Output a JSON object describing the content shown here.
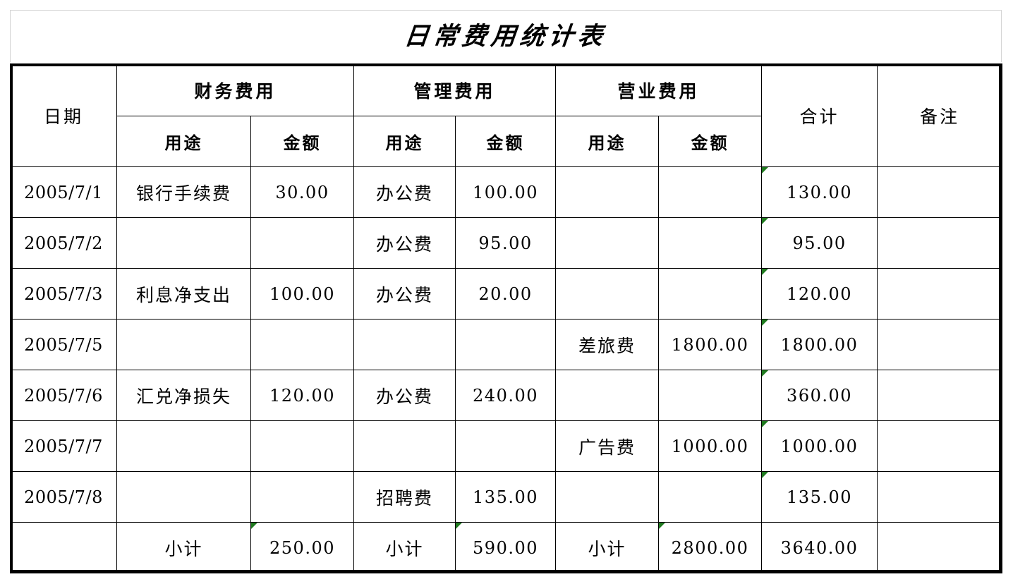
{
  "document": {
    "title": "日常费用统计表",
    "type": "spreadsheet"
  },
  "table": {
    "headers": {
      "date": "日期",
      "groups": [
        {
          "name": "财务费用",
          "sub": [
            "用途",
            "金额"
          ]
        },
        {
          "name": "管理费用",
          "sub": [
            "用途",
            "金额"
          ]
        },
        {
          "name": "营业费用",
          "sub": [
            "用途",
            "金额"
          ]
        }
      ],
      "total": "合计",
      "note": "备注"
    },
    "rows": [
      {
        "date": "2005/7/1",
        "finance_use": "银行手续费",
        "finance_amount": "30.00",
        "admin_use": "办公费",
        "admin_amount": "100.00",
        "sales_use": "",
        "sales_amount": "",
        "total": "130.00",
        "total_marker": true,
        "note": ""
      },
      {
        "date": "2005/7/2",
        "finance_use": "",
        "finance_amount": "",
        "admin_use": "办公费",
        "admin_amount": "95.00",
        "sales_use": "",
        "sales_amount": "",
        "total": "95.00",
        "total_marker": true,
        "note": ""
      },
      {
        "date": "2005/7/3",
        "finance_use": "利息净支出",
        "finance_amount": "100.00",
        "admin_use": "办公费",
        "admin_amount": "20.00",
        "sales_use": "",
        "sales_amount": "",
        "total": "120.00",
        "total_marker": true,
        "note": ""
      },
      {
        "date": "2005/7/5",
        "finance_use": "",
        "finance_amount": "",
        "admin_use": "",
        "admin_amount": "",
        "sales_use": "差旅费",
        "sales_amount": "1800.00",
        "total": "1800.00",
        "total_marker": true,
        "note": ""
      },
      {
        "date": "2005/7/6",
        "finance_use": "汇兑净损失",
        "finance_amount": "120.00",
        "admin_use": "办公费",
        "admin_amount": "240.00",
        "sales_use": "",
        "sales_amount": "",
        "total": "360.00",
        "total_marker": true,
        "note": ""
      },
      {
        "date": "2005/7/7",
        "finance_use": "",
        "finance_amount": "",
        "admin_use": "",
        "admin_amount": "",
        "sales_use": "广告费",
        "sales_amount": "1000.00",
        "total": "1000.00",
        "total_marker": true,
        "note": ""
      },
      {
        "date": "2005/7/8",
        "finance_use": "",
        "finance_amount": "",
        "admin_use": "招聘费",
        "admin_amount": "135.00",
        "sales_use": "",
        "sales_amount": "",
        "total": "135.00",
        "total_marker": true,
        "note": ""
      },
      {
        "date": "",
        "finance_use": "小计",
        "finance_amount": "250.00",
        "finance_amount_marker": true,
        "admin_use": "小计",
        "admin_amount": "590.00",
        "admin_amount_marker": true,
        "sales_use": "小计",
        "sales_amount": "2800.00",
        "sales_amount_marker": true,
        "total": "3640.00",
        "total_marker": false,
        "note": ""
      }
    ]
  },
  "style": {
    "grid_color": "#000000",
    "title_border_color": "#d4d4d4",
    "formula_marker_color": "#1f7a1f",
    "background": "#ffffff"
  }
}
